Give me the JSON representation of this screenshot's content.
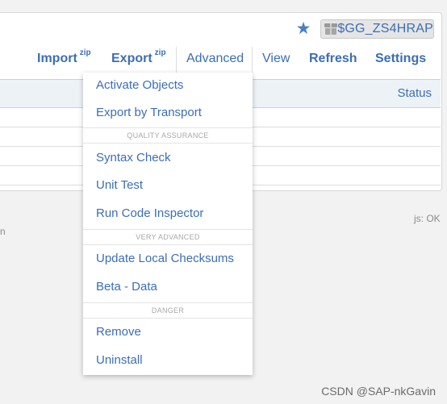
{
  "header": {
    "package": "$GG_ZS4HRAP",
    "favorite_icon": "star-icon",
    "package_icon": "package-icon"
  },
  "menu": {
    "import_label": "Import",
    "import_sup": "zip",
    "export_label": "Export",
    "export_sup": "zip",
    "advanced_label": "Advanced",
    "view_label": "View",
    "refresh_label": "Refresh",
    "settings_label": "Settings"
  },
  "table": {
    "status_header": "Status"
  },
  "status": {
    "js": "js: OK",
    "left_fragment": "n"
  },
  "dropdown": {
    "items": [
      "Activate Objects",
      "Export by Transport",
      "QUALITY ASSURANCE",
      "Syntax Check",
      "Unit Test",
      "Run Code Inspector",
      "VERY ADVANCED",
      "Update Local Checksums",
      "Beta - Data",
      "DANGER",
      "Remove",
      "Uninstall"
    ]
  },
  "watermark": "CSDN @SAP-nkGavin",
  "colors": {
    "link": "#3c6eb4",
    "header_bg": "#edf2f7",
    "page_bg": "#f2f2f2"
  }
}
